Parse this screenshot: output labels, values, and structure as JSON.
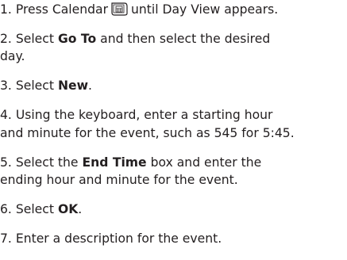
{
  "steps": [
    {
      "num": "1.",
      "pre": "Press Calendar",
      "post": "until Day View appears."
    },
    {
      "num": "2.",
      "pre": "Select",
      "bold": "Go To",
      "post": "and then select the desired",
      "line2": "day."
    },
    {
      "num": "3.",
      "pre": "Select",
      "bold": "New",
      "post": "."
    },
    {
      "num": "4.",
      "text": "Using the keyboard, enter a starting hour",
      "line2": "and minute for the event, such as 545 for 5:45."
    },
    {
      "num": "5.",
      "pre": "Select the",
      "bold": "End Time",
      "post": "box and enter the",
      "line2": "ending hour and minute for the event."
    },
    {
      "num": "6.",
      "pre": "Select",
      "bold": "OK",
      "post": "."
    },
    {
      "num": "7.",
      "text": "Enter a description for the event."
    }
  ],
  "icons": {
    "calendar_key": "calendar-key-icon"
  }
}
